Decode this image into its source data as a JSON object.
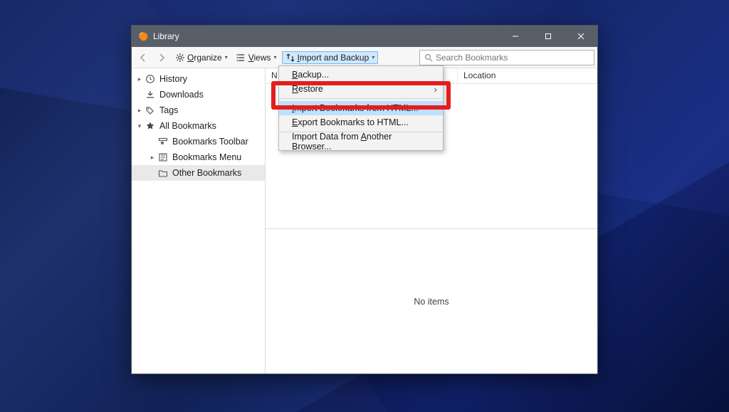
{
  "window": {
    "title": "Library"
  },
  "toolbar": {
    "organize": "Organize",
    "views": "Views",
    "import_backup": "Import and Backup"
  },
  "search": {
    "placeholder": "Search Bookmarks"
  },
  "columns": {
    "name": "N",
    "location": "Location"
  },
  "sidebar": {
    "history": "History",
    "downloads": "Downloads",
    "tags": "Tags",
    "all_bookmarks": "All Bookmarks",
    "bookmarks_toolbar": "Bookmarks Toolbar",
    "bookmarks_menu": "Bookmarks Menu",
    "other_bookmarks": "Other Bookmarks"
  },
  "menu": {
    "backup": "Backup...",
    "restore": "Restore",
    "import_html": "Import Bookmarks from HTML...",
    "export_html": "Export Bookmarks to HTML...",
    "import_browser": "Import Data from Another Browser..."
  },
  "detail": {
    "no_items": "No items"
  }
}
